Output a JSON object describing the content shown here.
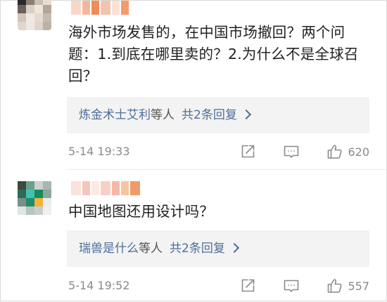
{
  "comments": [
    {
      "text": "海外市场发售的，在中国市场撤回？两个问题：1.到底在哪里卖的？2.为什么不是全球召回？",
      "reply_preview": {
        "name": "炼金术士艾利",
        "suffix": "等人",
        "count": "共2条回复"
      },
      "time": "5-14 19:33",
      "likes": "620",
      "avatar_icon": "pixelated-avatar",
      "avatar_colors": [
        "#2a2a2a",
        "#8a7f72",
        "#cbbfb3",
        "#e8ded4",
        "#6b6158",
        "#d9cfc5",
        "#efe6dc",
        "#b3a79b",
        "#cfc5ba",
        "#f1e9e1",
        "#e4dad0",
        "#c6bbb0",
        "#e0d6cc",
        "#f0e8e0",
        "#ded4ca",
        "#bdb1a5"
      ],
      "name_colors": [
        "#f7d8c8",
        "#f3b89c",
        "#ee8c5a",
        "#f2c4ad",
        "#fae3d6",
        "#f59a6b"
      ]
    },
    {
      "text": "中国地图还用设计吗？",
      "reply_preview": {
        "name": "瑞兽是什么",
        "suffix": "等人",
        "count": "共2条回复"
      },
      "time": "5-14 19:52",
      "likes": "557",
      "avatar_icon": "pixelated-avatar",
      "avatar_colors": [
        "#3a4a3e",
        "#6aa08a",
        "#c9d3cf",
        "#a9b7b2",
        "#2e6b55",
        "#44c0b4",
        "#178a5a",
        "#8fa69a",
        "#7a8f86",
        "#1e8e6a",
        "#f4b23a",
        "#e9eeec",
        "#dfe5e3",
        "#b9c4c0",
        "#c7cfcc",
        "#eef1f0"
      ],
      "name_colors": [
        "#fbe2dc",
        "#f6c6bc",
        "#fde9e4",
        "#f7d1c7",
        "#f8b8a8",
        "#f3c6a0",
        "#ef9a6a"
      ]
    }
  ]
}
